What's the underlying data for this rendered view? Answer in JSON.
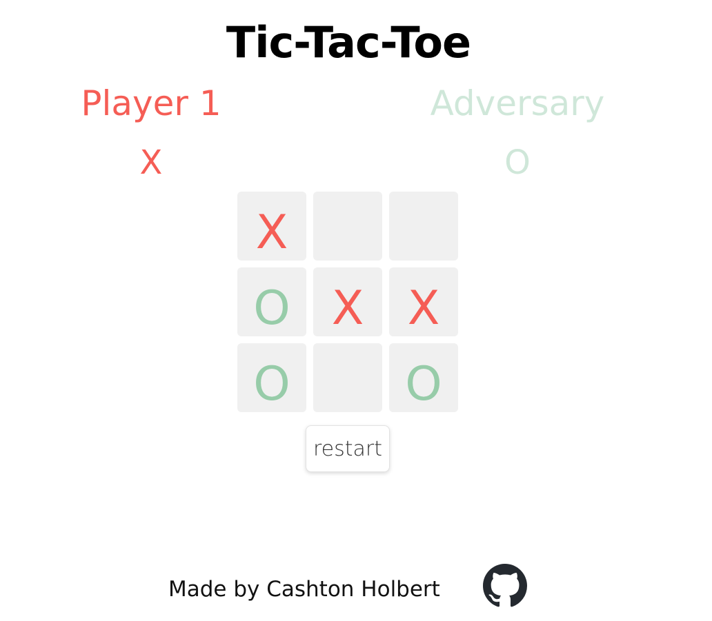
{
  "title": "Tic-Tac-Toe",
  "players": {
    "player1": {
      "name": "Player 1",
      "mark": "X",
      "color": "#f55d55"
    },
    "adversary": {
      "name": "Adversary",
      "mark": "O",
      "color": "#cfe7d9"
    }
  },
  "board": {
    "cells": [
      "X",
      "",
      "",
      "O",
      "X",
      "X",
      "O",
      "",
      "O"
    ],
    "x_color": "#f55d55",
    "o_color": "#97cca9",
    "cell_bg": "#f0f0f0"
  },
  "restart_label": "restart",
  "footer": {
    "text": "Made by Cashton Holbert",
    "icon": "github-icon"
  }
}
